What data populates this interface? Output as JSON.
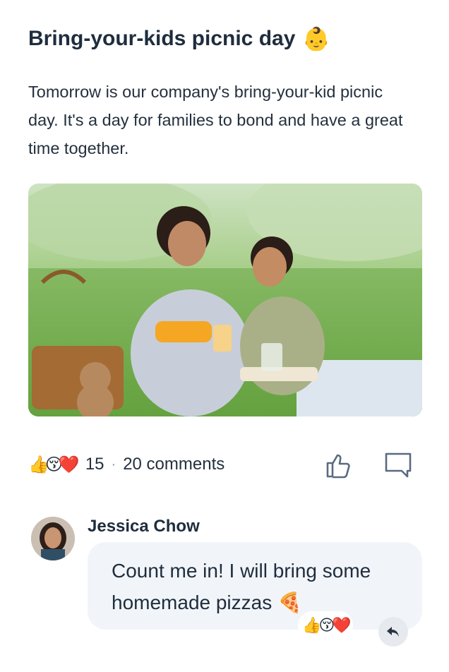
{
  "post": {
    "title": "Bring-your-kids picnic day",
    "title_emoji": "👶",
    "body": "Tomorrow is our company's bring-your-kid picnic day. It's a day for families to bond and have a great time together.",
    "photo_icon": "picnic-photo"
  },
  "stats": {
    "reactions": [
      "👍",
      "😚",
      "❤️"
    ],
    "count": "15",
    "separator": "·",
    "comments": "20 comments"
  },
  "actions": {
    "like_icon": "thumbs-up-icon",
    "comment_icon": "comment-icon"
  },
  "comment": {
    "author": "Jessica Chow",
    "text": "Count me in! I will bring some homemade pizzas",
    "text_emoji": "🍕",
    "reactions": [
      "👍",
      "😚",
      "❤️"
    ],
    "reply_icon": "reply-icon"
  },
  "colors": {
    "text": "#1f2d3d",
    "bubble": "#f1f5f9",
    "icon": "#5a6b80"
  }
}
